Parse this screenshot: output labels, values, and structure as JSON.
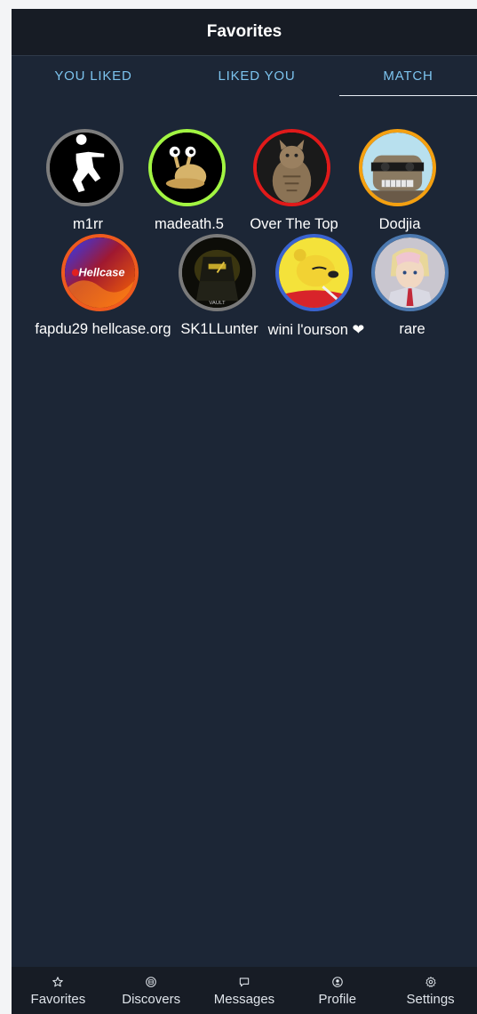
{
  "header": {
    "title": "Favorites"
  },
  "tabs": [
    {
      "label": "YOU LIKED"
    },
    {
      "label": "LIKED YOU"
    },
    {
      "label": "MATCH",
      "active": true
    }
  ],
  "matches": [
    {
      "name": "m1rr",
      "ring_color": "#7d7d7d",
      "icon": "soldier-silhouette-icon"
    },
    {
      "name": "madeath.5",
      "ring_color": "#a2f542",
      "icon": "snail-icon"
    },
    {
      "name": "Over The Top",
      "ring_color": "#e11a1a",
      "icon": "cat-photo-icon"
    },
    {
      "name": "Dodjia",
      "ring_color": "#f4a010",
      "icon": "cartoon-raccoon-icon"
    },
    {
      "name": "fapdu29 hellcase.org",
      "ring_color": "#ef5a1e",
      "icon": "hellcase-logo-icon"
    },
    {
      "name": "SK1LLunter",
      "ring_color": "#7a7a7a",
      "icon": "armored-figure-icon"
    },
    {
      "name": "wini l'ourson ❤",
      "ring_color": "#3a63d0",
      "icon": "yellow-bear-icon"
    },
    {
      "name": "rare",
      "ring_color": "#4c79b0",
      "icon": "anime-portrait-icon"
    }
  ],
  "avatar_texts": {
    "hellcase": "Hellcase",
    "vault": "VAULT"
  },
  "nav": [
    {
      "label": "Favorites",
      "icon": "star-icon"
    },
    {
      "label": "Discovers",
      "icon": "compass-icon"
    },
    {
      "label": "Messages",
      "icon": "chat-bubble-icon"
    },
    {
      "label": "Profile",
      "icon": "user-circle-icon"
    },
    {
      "label": "Settings",
      "icon": "gear-icon"
    }
  ],
  "colors": {
    "background": "#1c2636",
    "bar": "#171c25",
    "tab_text": "#7cc3ee"
  }
}
